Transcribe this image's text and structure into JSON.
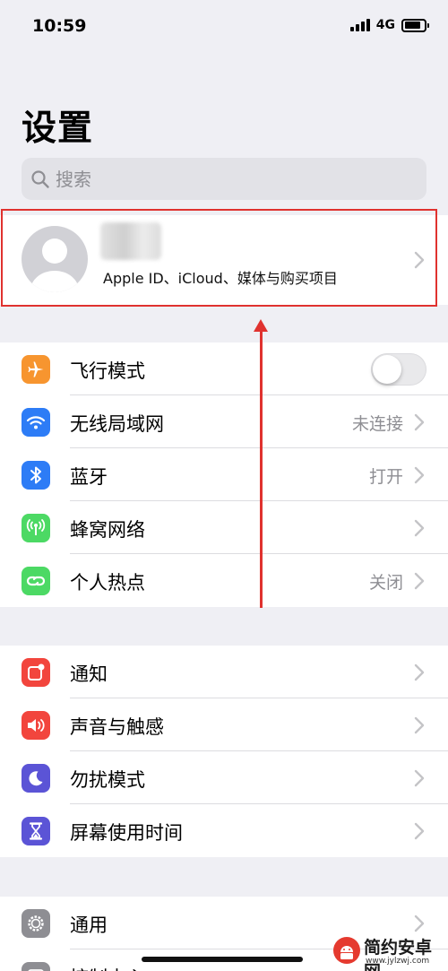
{
  "status_bar": {
    "time": "10:59",
    "network": "4G",
    "battery_level": 0.85
  },
  "page": {
    "title": "设置"
  },
  "search": {
    "placeholder": "搜索"
  },
  "profile": {
    "subtitle": "Apple ID、iCloud、媒体与购买项目"
  },
  "groups": [
    {
      "rows": [
        {
          "label": "飞行模式",
          "icon": "airplane-icon",
          "icon_color": "#f7952f",
          "toggle_on": false
        },
        {
          "label": "无线局域网",
          "icon": "wifi-icon",
          "icon_color": "#2d7cf6",
          "value": "未连接"
        },
        {
          "label": "蓝牙",
          "icon": "bluetooth-icon",
          "icon_color": "#2d7cf6",
          "value": "打开"
        },
        {
          "label": "蜂窝网络",
          "icon": "cellular-icon",
          "icon_color": "#4cd964",
          "value": ""
        },
        {
          "label": "个人热点",
          "icon": "hotspot-icon",
          "icon_color": "#4cd964",
          "value": "关闭"
        }
      ]
    },
    {
      "rows": [
        {
          "label": "通知",
          "icon": "notifications-icon",
          "icon_color": "#f2453d"
        },
        {
          "label": "声音与触感",
          "icon": "sound-icon",
          "icon_color": "#f2453d"
        },
        {
          "label": "勿扰模式",
          "icon": "moon-icon",
          "icon_color": "#5b54d6"
        },
        {
          "label": "屏幕使用时间",
          "icon": "hourglass-icon",
          "icon_color": "#5b54d6"
        }
      ]
    },
    {
      "rows": [
        {
          "label": "通用",
          "icon": "gear-icon",
          "icon_color": "#8e8e93"
        },
        {
          "label": "控制中心",
          "icon": "control-center-icon",
          "icon_color": "#8e8e93"
        }
      ]
    }
  ],
  "annotation": {
    "highlight_color": "#e0322f"
  },
  "watermark": {
    "title": "简约安卓网",
    "url": "www.jylzwj.com"
  }
}
